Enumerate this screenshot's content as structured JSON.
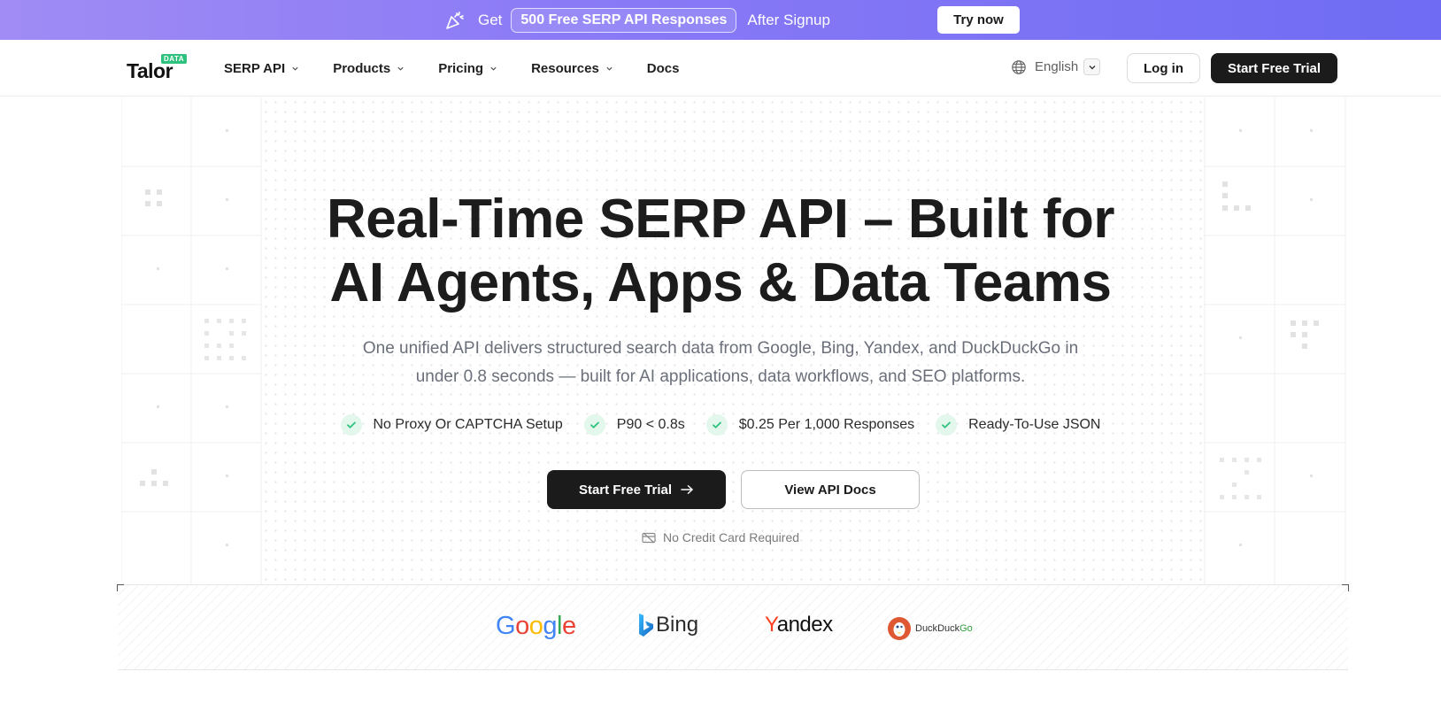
{
  "promo": {
    "get_label": "Get",
    "highlight": "500 Free SERP API Responses",
    "after": "After Signup",
    "cta": "Try now"
  },
  "nav": {
    "logo_text": "Talor",
    "logo_badge": "DATA",
    "items": [
      {
        "label": "SERP API",
        "has_dropdown": true
      },
      {
        "label": "Products",
        "has_dropdown": true
      },
      {
        "label": "Pricing",
        "has_dropdown": true
      },
      {
        "label": "Resources",
        "has_dropdown": true
      },
      {
        "label": "Docs",
        "has_dropdown": false
      }
    ],
    "language": "English",
    "login": "Log in",
    "trial": "Start Free Trial"
  },
  "hero": {
    "title_line1": "Real-Time SERP API – Built for",
    "title_line2": "AI Agents, Apps & Data Teams",
    "subtitle_line1": "One unified API delivers structured search data from Google, Bing, Yandex, and DuckDuckGo in",
    "subtitle_line2": "under 0.8 seconds — built for AI applications, data workflows, and SEO platforms.",
    "features": [
      "No Proxy Or CAPTCHA Setup",
      "P90 < 0.8s",
      "$0.25 Per 1,000 Responses",
      "Ready-To-Use JSON"
    ],
    "primary_cta": "Start Free Trial",
    "secondary_cta": "View API Docs",
    "note": "No Credit Card Required"
  },
  "engines": {
    "google": "Google",
    "bing": "Bing",
    "yandex": "Yandex",
    "duckduckgo_duck": "Duck",
    "duckduckgo_duck2": "Duck",
    "duckduckgo_go": "Go"
  },
  "colors": {
    "banner_start": "#a08cf4",
    "banner_end": "#6f6cf3",
    "primary_button": "#1b1b1b",
    "check_bg": "#e3f7ec",
    "check_mark": "#2ec27e",
    "logo_badge": "#2ec27e"
  }
}
